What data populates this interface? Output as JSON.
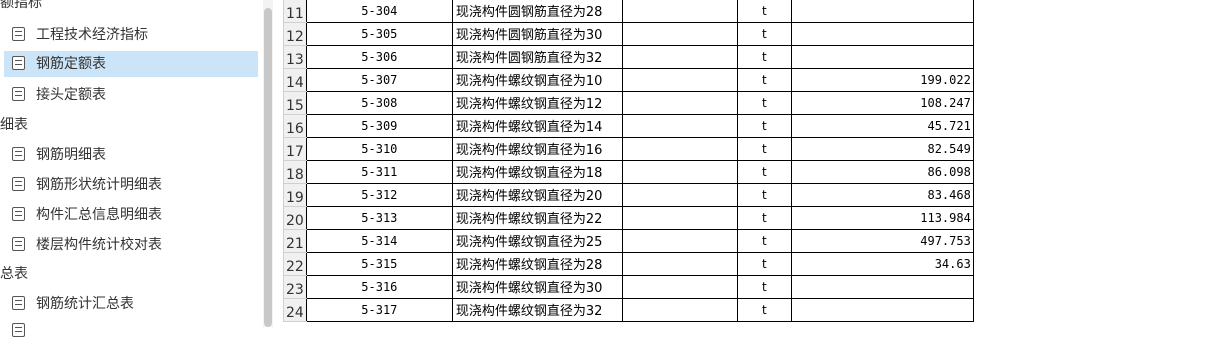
{
  "sidebar": {
    "groups": [
      {
        "label": "额指标",
        "items": [
          {
            "label": "工程技术经济指标",
            "selected": false
          },
          {
            "label": "钢筋定额表",
            "selected": true
          },
          {
            "label": "接头定额表",
            "selected": false
          }
        ]
      },
      {
        "label": "细表",
        "items": [
          {
            "label": "钢筋明细表",
            "selected": false
          },
          {
            "label": "钢筋形状统计明细表",
            "selected": false
          },
          {
            "label": "构件汇总信息明细表",
            "selected": false
          },
          {
            "label": "楼层构件统计校对表",
            "selected": false
          }
        ]
      },
      {
        "label": "总表",
        "items": [
          {
            "label": "钢筋统计汇总表",
            "selected": false
          }
        ]
      }
    ]
  },
  "table": {
    "rows": [
      {
        "num": "11",
        "code": "5-304",
        "name": "现浇构件圆钢筋直径为28",
        "unit": "t",
        "qty": ""
      },
      {
        "num": "12",
        "code": "5-305",
        "name": "现浇构件圆钢筋直径为30",
        "unit": "t",
        "qty": ""
      },
      {
        "num": "13",
        "code": "5-306",
        "name": "现浇构件圆钢筋直径为32",
        "unit": "t",
        "qty": ""
      },
      {
        "num": "14",
        "code": "5-307",
        "name": "现浇构件螺纹钢直径为10",
        "unit": "t",
        "qty": "199.022"
      },
      {
        "num": "15",
        "code": "5-308",
        "name": "现浇构件螺纹钢直径为12",
        "unit": "t",
        "qty": "108.247"
      },
      {
        "num": "16",
        "code": "5-309",
        "name": "现浇构件螺纹钢直径为14",
        "unit": "t",
        "qty": "45.721"
      },
      {
        "num": "17",
        "code": "5-310",
        "name": "现浇构件螺纹钢直径为16",
        "unit": "t",
        "qty": "82.549"
      },
      {
        "num": "18",
        "code": "5-311",
        "name": "现浇构件螺纹钢直径为18",
        "unit": "t",
        "qty": "86.098"
      },
      {
        "num": "19",
        "code": "5-312",
        "name": "现浇构件螺纹钢直径为20",
        "unit": "t",
        "qty": "83.468"
      },
      {
        "num": "20",
        "code": "5-313",
        "name": "现浇构件螺纹钢直径为22",
        "unit": "t",
        "qty": "113.984"
      },
      {
        "num": "21",
        "code": "5-314",
        "name": "现浇构件螺纹钢直径为25",
        "unit": "t",
        "qty": "497.753"
      },
      {
        "num": "22",
        "code": "5-315",
        "name": "现浇构件螺纹钢直径为28",
        "unit": "t",
        "qty": "34.63"
      },
      {
        "num": "23",
        "code": "5-316",
        "name": "现浇构件螺纹钢直径为30",
        "unit": "t",
        "qty": ""
      },
      {
        "num": "24",
        "code": "5-317",
        "name": "现浇构件螺纹钢直径为32",
        "unit": "t",
        "qty": ""
      }
    ]
  },
  "colors": {
    "selected_bg": "#cce4f7",
    "row_header_bg": "#f0f0f0"
  }
}
